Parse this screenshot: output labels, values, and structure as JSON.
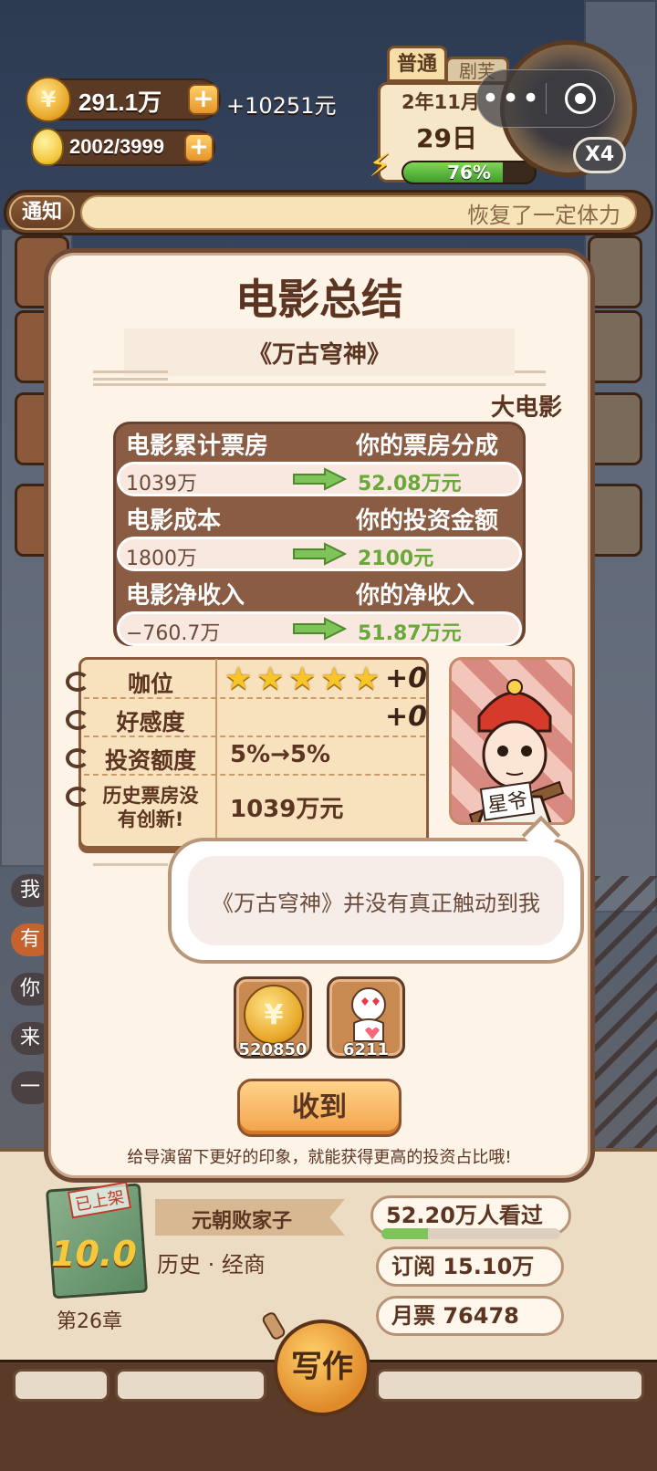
{
  "hud": {
    "coins": "291.1万",
    "income": "+10251元",
    "energy_points": "2002/3999",
    "plus_glyph": "+",
    "coin_glyph": "¥"
  },
  "calendar": {
    "mode_tab": "普通",
    "second_tab": "剧芙",
    "month": "2年11月",
    "day": "29日",
    "energy_percent": 76,
    "energy_label": "76%",
    "speed": "X4",
    "mini_program_dots": "•••"
  },
  "notice": {
    "tag": "通知",
    "text": "恢复了一定体力"
  },
  "side_menu": {
    "chips": [
      "我",
      "有",
      "你",
      "来",
      "一"
    ]
  },
  "modal": {
    "title": "电影总结",
    "movie_name": "《万古穹神》",
    "category": "大电影",
    "stats": [
      {
        "left_label": "电影累计票房",
        "right_label": "你的票房分成",
        "left_value": "1039万",
        "right_value": "52.08万元"
      },
      {
        "left_label": "电影成本",
        "right_label": "你的投资金额",
        "left_value": "1800万",
        "right_value": "2100元"
      },
      {
        "left_label": "电影净收入",
        "right_label": "你的净收入",
        "left_value": "−760.7万",
        "right_value": "51.87万元"
      }
    ],
    "notebook": {
      "rank_label": "咖位",
      "rank_stars": 5,
      "rank_delta": "+0",
      "favor_label": "好感度",
      "favor_delta": "+0",
      "invest_label": "投资额度",
      "invest_value": "5%→5%",
      "record_label_line1": "历史票房没",
      "record_label_line2": "有创新!",
      "record_value": "1039万元"
    },
    "character_name": "星爷",
    "speech": "《万古穹神》并没有真正触动到我",
    "rewards": [
      {
        "icon": "gold-coin-icon",
        "amount": "520850"
      },
      {
        "icon": "fan-love-icon",
        "amount": "6211"
      }
    ],
    "receive_button": "收到",
    "tip": "给导演留下更好的印象，就能获得更高的投资占比哦!"
  },
  "book": {
    "status_tag": "已上架",
    "score": "10.0",
    "title": "元朝败家子",
    "genre": "历史 · 经商",
    "chapter": "第26章",
    "views": "52.20万人看过",
    "subscriptions": "订阅 15.10万",
    "monthly_tickets": "月票 76478"
  },
  "bottom_bar": {
    "write_button": "写作"
  },
  "colors": {
    "panel_bg": "#fdf3e6",
    "brown_dark": "#5b3521",
    "green_value": "#6aa83a",
    "button_orange": "#f2a24a"
  }
}
